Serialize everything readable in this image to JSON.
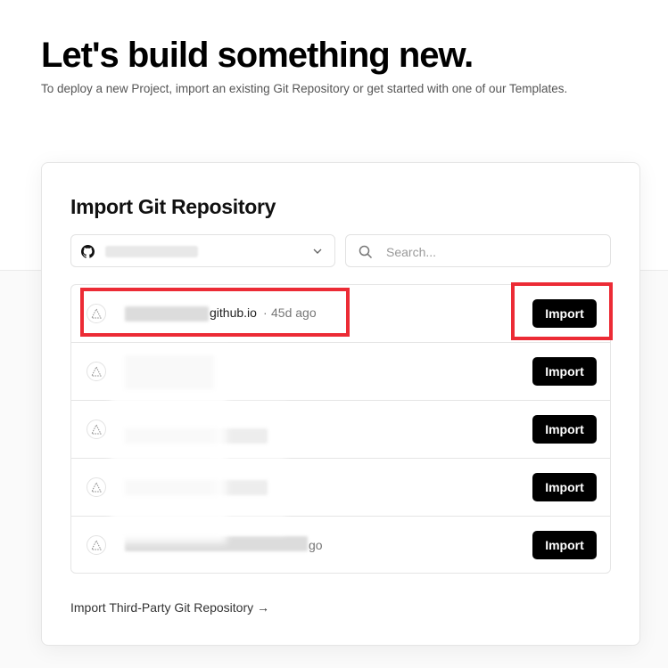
{
  "page": {
    "headline": "Let's build something new.",
    "subline": "To deploy a new Project, import an existing Git Repository or get started with one of our Templates."
  },
  "import_card": {
    "title": "Import Git Repository",
    "account_selector": {
      "icon": "github-icon",
      "selected_value": ""
    },
    "search": {
      "placeholder": "Search...",
      "value": ""
    },
    "repositories": [
      {
        "name_visible": "github.io",
        "separator": " · ",
        "updated": "45d ago",
        "button": "Import",
        "icon": "framework-triangle-icon"
      },
      {
        "name_visible": "",
        "updated": "",
        "button": "Import",
        "icon": "framework-triangle-icon"
      },
      {
        "name_visible": "",
        "updated": "",
        "button": "Import",
        "icon": "framework-triangle-icon"
      },
      {
        "name_visible": "",
        "updated": "",
        "button": "Import",
        "icon": "framework-triangle-icon"
      },
      {
        "name_visible": "",
        "updated": "go",
        "button": "Import",
        "icon": "framework-triangle-icon"
      }
    ],
    "third_party_link": "Import Third-Party Git Repository →"
  },
  "colors": {
    "accent": "#000000",
    "annotation": "#ec2b35",
    "background": "#fafafa"
  }
}
